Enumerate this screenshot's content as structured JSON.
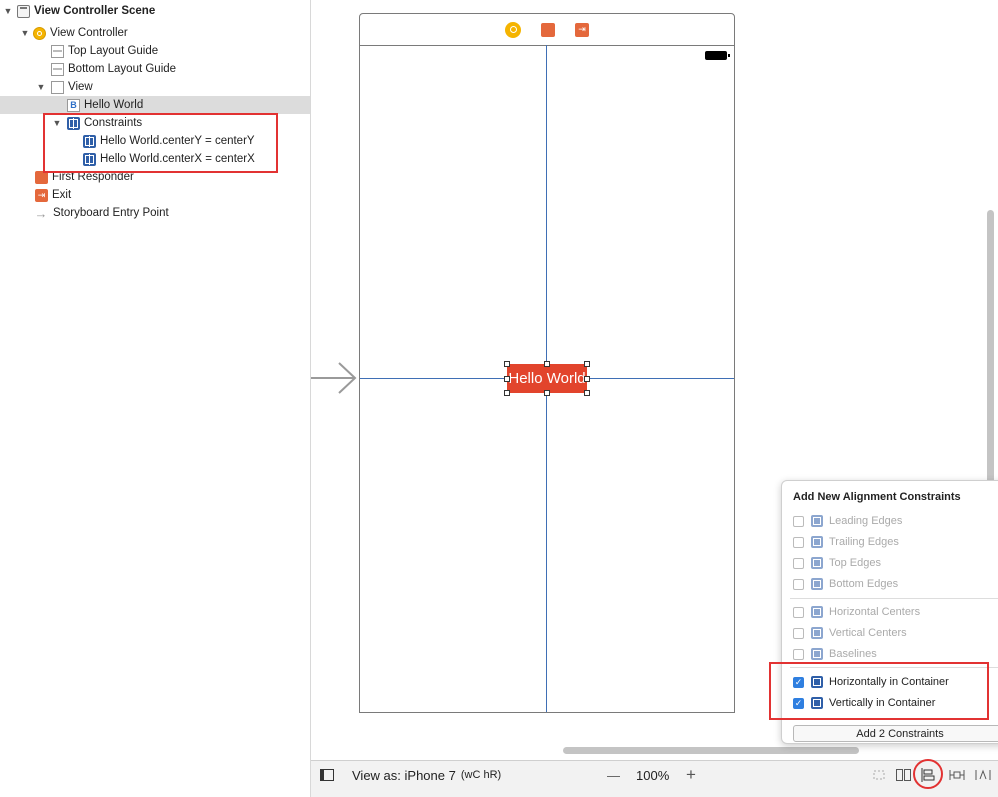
{
  "outline": {
    "items": [
      {
        "label": "View Controller Scene",
        "bold": true
      },
      {
        "label": "View Controller"
      },
      {
        "label": "Top Layout Guide"
      },
      {
        "label": "Bottom Layout Guide"
      },
      {
        "label": "View"
      },
      {
        "label": "Hello World"
      },
      {
        "label": "Constraints"
      },
      {
        "label": "Hello World.centerY = centerY"
      },
      {
        "label": "Hello World.centerX = centerX"
      },
      {
        "label": "First Responder"
      },
      {
        "label": "Exit"
      },
      {
        "label": "Storyboard Entry Point"
      }
    ],
    "label_glyph": "B",
    "exit_glyph": "⇥",
    "entry_glyph": "→",
    "collapse_glyph": "▼"
  },
  "canvas": {
    "hello_label": "Hello World",
    "exit_glyph": "⇥"
  },
  "bottom_bar": {
    "view_as": "View as: iPhone 7",
    "size_class": "(wC hR)",
    "zoom_out": "—",
    "zoom": "100%",
    "zoom_in": "+"
  },
  "popover": {
    "title": "Add New Alignment Constraints",
    "options": [
      {
        "label": "Leading Edges",
        "checked": false,
        "enabled": false
      },
      {
        "label": "Trailing Edges",
        "checked": false,
        "enabled": false
      },
      {
        "label": "Top Edges",
        "checked": false,
        "enabled": false
      },
      {
        "label": "Bottom Edges",
        "checked": false,
        "enabled": false
      },
      {
        "label": "Horizontal Centers",
        "checked": false,
        "enabled": false
      },
      {
        "label": "Vertical Centers",
        "checked": false,
        "enabled": false
      },
      {
        "label": "Baselines",
        "checked": false,
        "enabled": false
      },
      {
        "label": "Horizontally in Container",
        "checked": true,
        "enabled": true
      },
      {
        "label": "Vertically in Container",
        "checked": true,
        "enabled": true
      }
    ],
    "button": "Add 2 Constraints",
    "check_glyph": "✓"
  },
  "colors": {
    "highlight_red": "#e23232",
    "label_fill": "#e2442c",
    "guide_blue": "#3f6fb5",
    "constraint_icon": "#2f5fa8"
  }
}
